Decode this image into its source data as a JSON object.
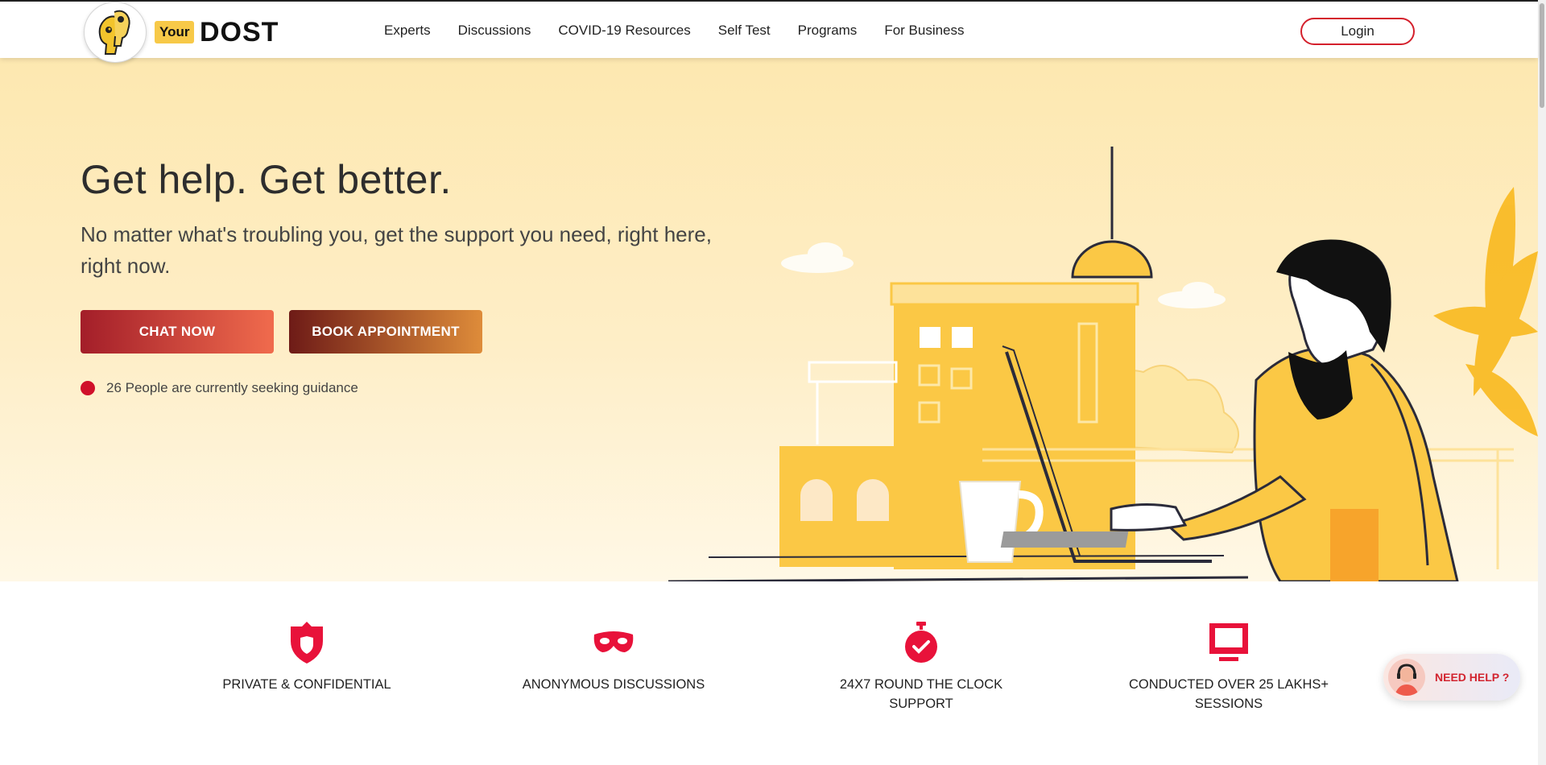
{
  "brand": {
    "your": "Your",
    "dost": "DOST"
  },
  "nav": {
    "items": [
      {
        "label": "Experts"
      },
      {
        "label": "Discussions"
      },
      {
        "label": "COVID-19 Resources"
      },
      {
        "label": "Self Test"
      },
      {
        "label": "Programs"
      },
      {
        "label": "For Business"
      }
    ],
    "login": "Login"
  },
  "hero": {
    "title": "Get help. Get better.",
    "subtitle": "No matter what's troubling you, get the support you need, right here, right now.",
    "chat_button": "CHAT NOW",
    "book_button": "BOOK APPOINTMENT",
    "seeking_text": "26 People are currently seeking guidance"
  },
  "features": [
    {
      "icon": "shield-icon",
      "label": "PRIVATE & CONFIDENTIAL"
    },
    {
      "icon": "mask-icon",
      "label": "ANONYMOUS DISCUSSIONS"
    },
    {
      "icon": "stopwatch-icon",
      "label": "24X7 ROUND THE CLOCK SUPPORT"
    },
    {
      "icon": "monitor-icon",
      "label": "CONDUCTED OVER 25 LAKHS+ SESSIONS"
    }
  ],
  "help_widget": {
    "label": "NEED HELP ?"
  },
  "colors": {
    "accent_red": "#d4202c",
    "feature_icon": "#e8123a",
    "logo_yellow": "#f7c948",
    "hero_background": "#fde8b0"
  }
}
